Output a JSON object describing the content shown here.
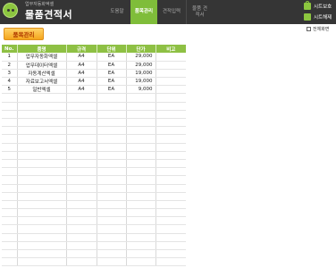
{
  "header": {
    "subtitle": "업무자동화엑셀",
    "title": "물품견적서",
    "tabs": [
      {
        "label": "도움말",
        "active": false
      },
      {
        "label": "품목관리",
        "active": true
      },
      {
        "label": "견적입력",
        "active": false
      },
      {
        "label": "물품 견적서",
        "active": false
      }
    ],
    "sheet_protect": "시트보호",
    "sheet_unprotect": "시트해제"
  },
  "options": {
    "fullscreen_label": "전체화면",
    "fullscreen_checked": false
  },
  "section": {
    "label": "품목관리"
  },
  "table": {
    "columns": [
      "No.",
      "품명",
      "규격",
      "단위",
      "단가",
      "비고"
    ],
    "rows": [
      {
        "no": "1",
        "name": "업무자동화엑셀",
        "spec": "A4",
        "unit": "EA",
        "price": "29,000",
        "note": ""
      },
      {
        "no": "2",
        "name": "업무데이터엑셀",
        "spec": "A4",
        "unit": "EA",
        "price": "29,000",
        "note": ""
      },
      {
        "no": "3",
        "name": "자동계산엑셀",
        "spec": "A4",
        "unit": "EA",
        "price": "19,000",
        "note": ""
      },
      {
        "no": "4",
        "name": "자료보고서엑셀",
        "spec": "A4",
        "unit": "EA",
        "price": "19,000",
        "note": ""
      },
      {
        "no": "5",
        "name": "일반엑셀",
        "spec": "A4",
        "unit": "EA",
        "price": "9,000",
        "note": ""
      }
    ]
  },
  "colors": {
    "accent_green": "#8ec044",
    "header_dark": "#353535",
    "section_orange": "#f4a51c"
  }
}
